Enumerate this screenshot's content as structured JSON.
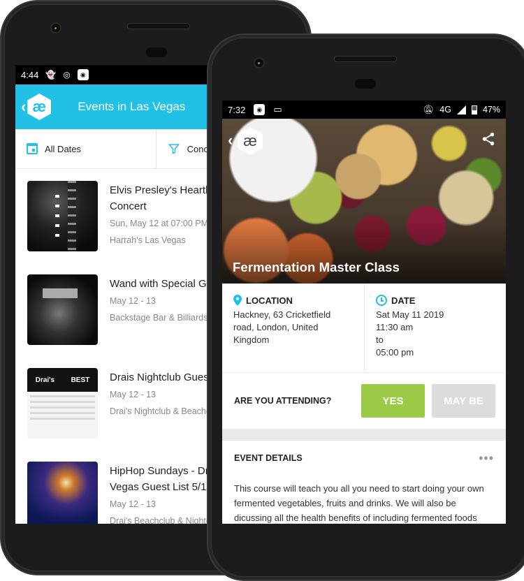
{
  "back_phone": {
    "status_bar": {
      "time": "4:44",
      "icons": [
        "snapchat-icon",
        "instagram-icon",
        "app-icon"
      ]
    },
    "app_bar": {
      "title": "Events in Las Vegas",
      "logo_glyph": "æ"
    },
    "filters": {
      "dates_label": "All Dates",
      "second_label": "Conc"
    },
    "events": [
      {
        "title_line1": "Elvis Presley's Heartb",
        "title_line2": "Concert",
        "date": "Sun, May 12 at 07:00 PM",
        "venue": "Harrah's Las Vegas"
      },
      {
        "title_line1": "Wand with Special Gu",
        "title_line2": "",
        "date": "May 12 - 13",
        "venue": "Backstage Bar & Billiards"
      },
      {
        "title_line1": "Drais Nightclub Gues",
        "title_line2": "",
        "date": "May 12 - 13",
        "venue": "Drai's Nightclub & Beachc"
      },
      {
        "title_line1": "HipHop Sundays - Dr",
        "title_line2": "Vegas Guest List 5/1",
        "date": "May 12 - 13",
        "venue": "Drai's Beachclub & Nighto"
      }
    ],
    "thumb3": {
      "left_text": "Drai's",
      "right_text": "BEST"
    }
  },
  "front_phone": {
    "status_bar": {
      "time": "7:32",
      "network": "4G",
      "battery": "47%"
    },
    "hero": {
      "title": "Fermentation Master Class",
      "logo_glyph": "æ"
    },
    "location": {
      "label": "LOCATION",
      "address": "Hackney, 63 Cricketfield road, London, United Kingdom"
    },
    "date": {
      "label": "DATE",
      "day": "Sat May 11 2019",
      "start": "11:30 am",
      "sep": "to",
      "end": "05:00 pm"
    },
    "attending": {
      "question": "ARE YOU ATTENDING?",
      "yes_label": "YES",
      "maybe_label": "MAY BE"
    },
    "details": {
      "title": "EVENT DETAILS",
      "more": "•••",
      "body": "This course will teach you all you need to start doing your own fermented vegetables, fruits and drinks. We will also be dicussing all the health benefits of including fermented foods"
    }
  },
  "colors": {
    "accent": "#21c0e6",
    "yes": "#9bcb46",
    "maybe": "#dcdcdc"
  }
}
